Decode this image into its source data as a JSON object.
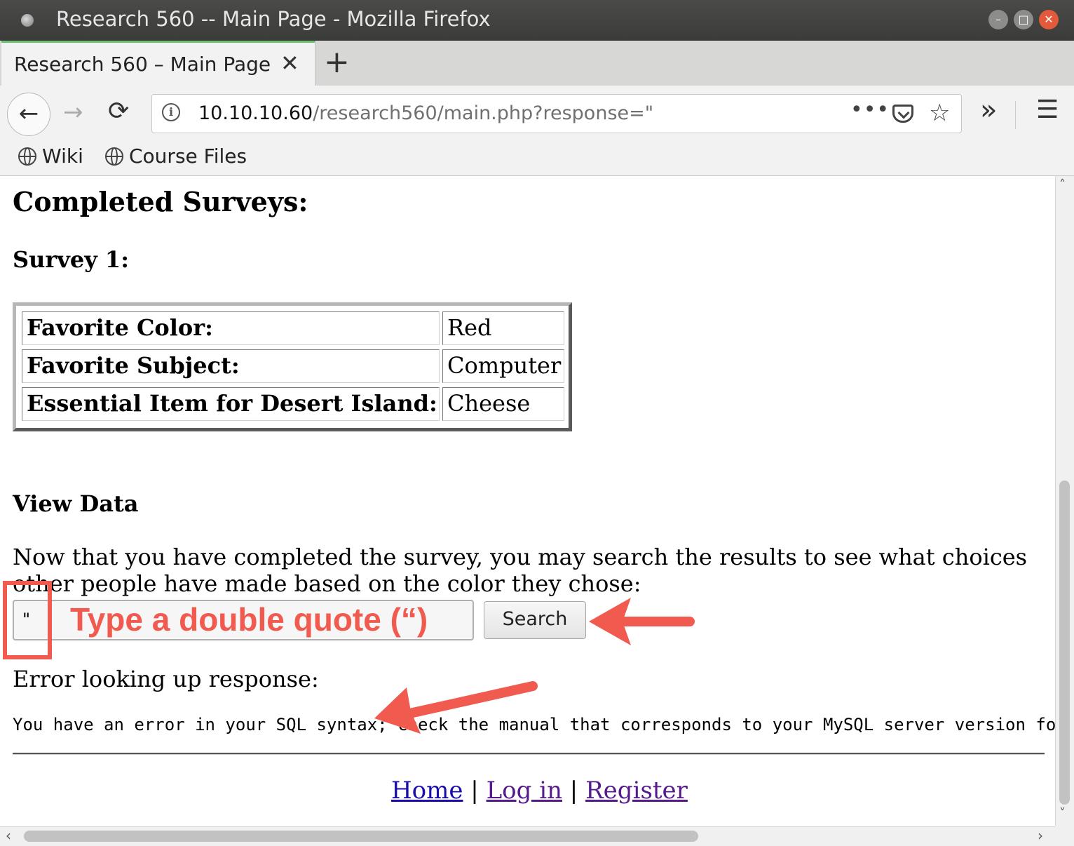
{
  "window": {
    "title": "Research 560 -- Main Page - Mozilla Firefox",
    "controls": {
      "minimize": "–",
      "maximize": "□",
      "close": "✕"
    }
  },
  "tabs": [
    {
      "label": "Research 560 – Main Page",
      "close": "✕",
      "active": true
    }
  ],
  "new_tab": "+",
  "nav": {
    "back": "←",
    "forward": "→",
    "reload": "⟳",
    "info_icon": "i",
    "url_host": "10.10.10.60",
    "url_path": "/research560/main.php?response=\"",
    "more": "•••",
    "star": "☆",
    "overflow": "»",
    "menu": "☰"
  },
  "bookmarks": [
    {
      "label": "Wiki",
      "icon": "globe-icon"
    },
    {
      "label": "Course Files",
      "icon": "globe-icon"
    }
  ],
  "page": {
    "heading": "Completed Surveys:",
    "survey_heading": "Survey 1:",
    "survey_rows": [
      {
        "key": "Favorite Color:",
        "value": "Red"
      },
      {
        "key": "Favorite Subject:",
        "value": "Computer"
      },
      {
        "key": "Essential Item for Desert Island:",
        "value": "Cheese"
      }
    ],
    "view_heading": "View Data",
    "description": "Now that you have completed the survey, you may search the results to see what choices other people have made based on the color they chose:",
    "search_value": "\"",
    "search_button": "Search",
    "error_label": "Error looking up response:",
    "error_message": "You have an error in your SQL syntax; check the manual that corresponds to your MySQL server version for th",
    "footer": {
      "home": "Home",
      "sep": "|",
      "login": "Log in",
      "register": "Register"
    }
  },
  "annotation": {
    "text": "Type a double quote (“)",
    "color": "#f15a4f"
  },
  "scroll": {
    "up": "˄",
    "down": "˅",
    "left": "‹",
    "right": "›"
  }
}
